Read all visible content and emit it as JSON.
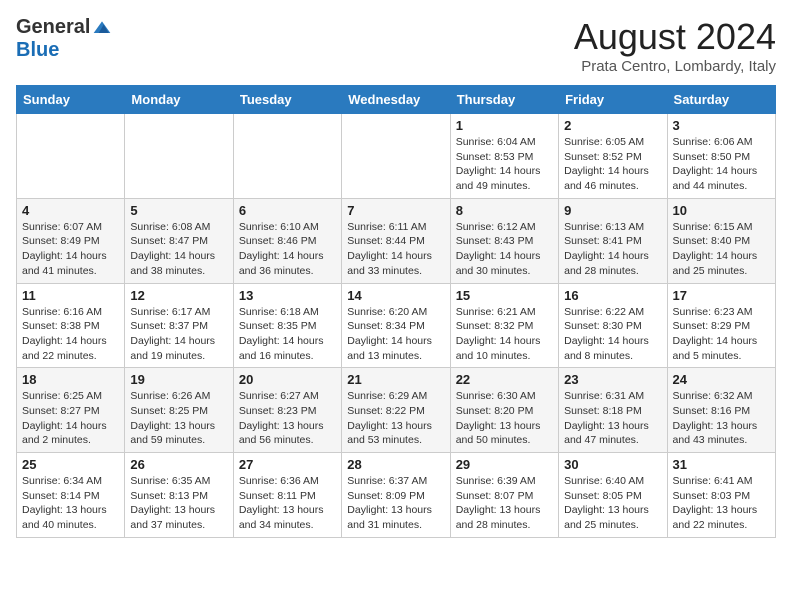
{
  "header": {
    "logo_general": "General",
    "logo_blue": "Blue",
    "month_year": "August 2024",
    "location": "Prata Centro, Lombardy, Italy"
  },
  "weekdays": [
    "Sunday",
    "Monday",
    "Tuesday",
    "Wednesday",
    "Thursday",
    "Friday",
    "Saturday"
  ],
  "weeks": [
    [
      {
        "day": "",
        "info": ""
      },
      {
        "day": "",
        "info": ""
      },
      {
        "day": "",
        "info": ""
      },
      {
        "day": "",
        "info": ""
      },
      {
        "day": "1",
        "info": "Sunrise: 6:04 AM\nSunset: 8:53 PM\nDaylight: 14 hours\nand 49 minutes."
      },
      {
        "day": "2",
        "info": "Sunrise: 6:05 AM\nSunset: 8:52 PM\nDaylight: 14 hours\nand 46 minutes."
      },
      {
        "day": "3",
        "info": "Sunrise: 6:06 AM\nSunset: 8:50 PM\nDaylight: 14 hours\nand 44 minutes."
      }
    ],
    [
      {
        "day": "4",
        "info": "Sunrise: 6:07 AM\nSunset: 8:49 PM\nDaylight: 14 hours\nand 41 minutes."
      },
      {
        "day": "5",
        "info": "Sunrise: 6:08 AM\nSunset: 8:47 PM\nDaylight: 14 hours\nand 38 minutes."
      },
      {
        "day": "6",
        "info": "Sunrise: 6:10 AM\nSunset: 8:46 PM\nDaylight: 14 hours\nand 36 minutes."
      },
      {
        "day": "7",
        "info": "Sunrise: 6:11 AM\nSunset: 8:44 PM\nDaylight: 14 hours\nand 33 minutes."
      },
      {
        "day": "8",
        "info": "Sunrise: 6:12 AM\nSunset: 8:43 PM\nDaylight: 14 hours\nand 30 minutes."
      },
      {
        "day": "9",
        "info": "Sunrise: 6:13 AM\nSunset: 8:41 PM\nDaylight: 14 hours\nand 28 minutes."
      },
      {
        "day": "10",
        "info": "Sunrise: 6:15 AM\nSunset: 8:40 PM\nDaylight: 14 hours\nand 25 minutes."
      }
    ],
    [
      {
        "day": "11",
        "info": "Sunrise: 6:16 AM\nSunset: 8:38 PM\nDaylight: 14 hours\nand 22 minutes."
      },
      {
        "day": "12",
        "info": "Sunrise: 6:17 AM\nSunset: 8:37 PM\nDaylight: 14 hours\nand 19 minutes."
      },
      {
        "day": "13",
        "info": "Sunrise: 6:18 AM\nSunset: 8:35 PM\nDaylight: 14 hours\nand 16 minutes."
      },
      {
        "day": "14",
        "info": "Sunrise: 6:20 AM\nSunset: 8:34 PM\nDaylight: 14 hours\nand 13 minutes."
      },
      {
        "day": "15",
        "info": "Sunrise: 6:21 AM\nSunset: 8:32 PM\nDaylight: 14 hours\nand 10 minutes."
      },
      {
        "day": "16",
        "info": "Sunrise: 6:22 AM\nSunset: 8:30 PM\nDaylight: 14 hours\nand 8 minutes."
      },
      {
        "day": "17",
        "info": "Sunrise: 6:23 AM\nSunset: 8:29 PM\nDaylight: 14 hours\nand 5 minutes."
      }
    ],
    [
      {
        "day": "18",
        "info": "Sunrise: 6:25 AM\nSunset: 8:27 PM\nDaylight: 14 hours\nand 2 minutes."
      },
      {
        "day": "19",
        "info": "Sunrise: 6:26 AM\nSunset: 8:25 PM\nDaylight: 13 hours\nand 59 minutes."
      },
      {
        "day": "20",
        "info": "Sunrise: 6:27 AM\nSunset: 8:23 PM\nDaylight: 13 hours\nand 56 minutes."
      },
      {
        "day": "21",
        "info": "Sunrise: 6:29 AM\nSunset: 8:22 PM\nDaylight: 13 hours\nand 53 minutes."
      },
      {
        "day": "22",
        "info": "Sunrise: 6:30 AM\nSunset: 8:20 PM\nDaylight: 13 hours\nand 50 minutes."
      },
      {
        "day": "23",
        "info": "Sunrise: 6:31 AM\nSunset: 8:18 PM\nDaylight: 13 hours\nand 47 minutes."
      },
      {
        "day": "24",
        "info": "Sunrise: 6:32 AM\nSunset: 8:16 PM\nDaylight: 13 hours\nand 43 minutes."
      }
    ],
    [
      {
        "day": "25",
        "info": "Sunrise: 6:34 AM\nSunset: 8:14 PM\nDaylight: 13 hours\nand 40 minutes."
      },
      {
        "day": "26",
        "info": "Sunrise: 6:35 AM\nSunset: 8:13 PM\nDaylight: 13 hours\nand 37 minutes."
      },
      {
        "day": "27",
        "info": "Sunrise: 6:36 AM\nSunset: 8:11 PM\nDaylight: 13 hours\nand 34 minutes."
      },
      {
        "day": "28",
        "info": "Sunrise: 6:37 AM\nSunset: 8:09 PM\nDaylight: 13 hours\nand 31 minutes."
      },
      {
        "day": "29",
        "info": "Sunrise: 6:39 AM\nSunset: 8:07 PM\nDaylight: 13 hours\nand 28 minutes."
      },
      {
        "day": "30",
        "info": "Sunrise: 6:40 AM\nSunset: 8:05 PM\nDaylight: 13 hours\nand 25 minutes."
      },
      {
        "day": "31",
        "info": "Sunrise: 6:41 AM\nSunset: 8:03 PM\nDaylight: 13 hours\nand 22 minutes."
      }
    ]
  ]
}
